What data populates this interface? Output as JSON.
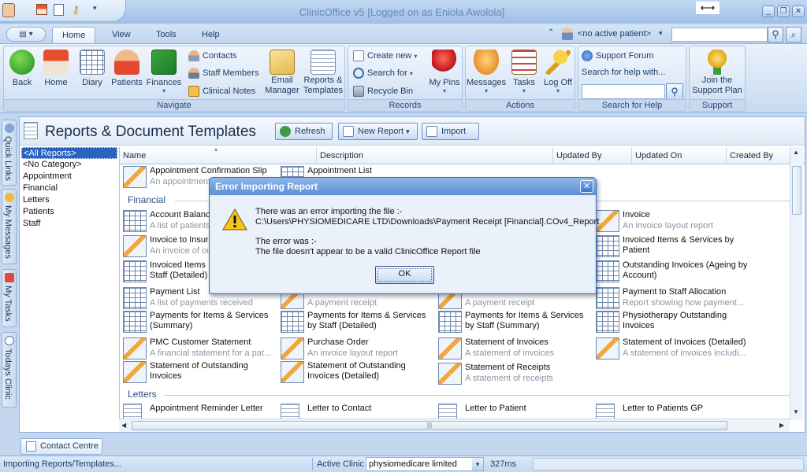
{
  "window": {
    "title": "ClinicOffice v5 [Logged on as Eniola Awolola]"
  },
  "tabs": [
    "Home",
    "View",
    "Tools",
    "Help"
  ],
  "patient_selector": "<no active patient>",
  "ribbon": {
    "navigate": {
      "label": "Navigate",
      "back": "Back",
      "home": "Home",
      "diary": "Diary",
      "patients": "Patients",
      "finances": "Finances",
      "contacts": "Contacts",
      "staff_members": "Staff Members",
      "clinical_notes": "Clinical Notes",
      "email_manager": "Email Manager",
      "reports_templates": "Reports & Templates"
    },
    "records": {
      "label": "Records",
      "create_new": "Create new",
      "search_for": "Search for",
      "recycle_bin": "Recycle Bin",
      "my_pins": "My Pins"
    },
    "actions": {
      "label": "Actions",
      "messages": "Messages",
      "tasks": "Tasks",
      "log_off": "Log Off"
    },
    "search_help": {
      "label": "Search for Help",
      "support_forum": "Support Forum",
      "search_prompt": "Search for help with..."
    },
    "support": {
      "label": "Support",
      "join_plan": "Join the Support Plan"
    }
  },
  "side_tabs": [
    "Quick Links",
    "My Messages",
    "My Tasks",
    "Todays Clinic"
  ],
  "page": {
    "title": "Reports & Document Templates",
    "refresh": "Refresh",
    "new_report": "New Report",
    "import": "Import"
  },
  "categories": [
    "<All Reports>",
    "<No Category>",
    "Appointment",
    "Financial",
    "Letters",
    "Patients",
    "Staff"
  ],
  "columns": [
    "Name",
    "Description",
    "Updated By",
    "Updated On",
    "Created By"
  ],
  "groups": {
    "financial": "Financial",
    "letters": "Letters"
  },
  "appointment_items": [
    {
      "name": "Appointment Confirmation Slip",
      "desc": "An appointment..."
    },
    {
      "name": "Appointment List",
      "desc": ""
    }
  ],
  "financial_items": [
    {
      "name": "Account Balance",
      "desc": "A list of patients"
    },
    {
      "name": "Invoice",
      "desc": "An invoice layout report"
    },
    {
      "name": "Invoice to Insur",
      "desc": "An invoice of ou"
    },
    {
      "name": "Invoiced Items & Services by Patient",
      "desc": ""
    },
    {
      "name": "Invoiced Items Staff (Detailed)",
      "desc": ""
    },
    {
      "name": "Outstanding Invoices (Ageing by Account)",
      "desc": ""
    },
    {
      "name": "Payment List",
      "desc": "A list of payments received"
    },
    {
      "name": "",
      "desc": "A payment receipt"
    },
    {
      "name": "",
      "desc": "A payment receipt"
    },
    {
      "name": "Payment to Staff Allocation",
      "desc": "Report showing how payment..."
    },
    {
      "name": "Payments for Items & Services (Summary)",
      "desc": ""
    },
    {
      "name": "Payments for Items & Services by Staff (Detailed)",
      "desc": ""
    },
    {
      "name": "Payments for Items & Services by Staff (Summary)",
      "desc": ""
    },
    {
      "name": "Physiotherapy Outstanding Invoices",
      "desc": ""
    },
    {
      "name": "PMC Customer Statement",
      "desc": "A financial statement for a pat..."
    },
    {
      "name": "Purchase Order",
      "desc": "An invoice layout report"
    },
    {
      "name": "Statement of Invoices",
      "desc": "A statement of invoices"
    },
    {
      "name": "Statement of Invoices (Detailed)",
      "desc": "A statement of invoices includi..."
    },
    {
      "name": "Statement of Outstanding Invoices",
      "desc": ""
    },
    {
      "name": "Statement of Outstanding Invoices (Detailed)",
      "desc": ""
    },
    {
      "name": "Statement of Receipts",
      "desc": "A statement of receipts"
    }
  ],
  "letter_items": [
    {
      "name": "Appointment Reminder Letter"
    },
    {
      "name": "Letter to Contact"
    },
    {
      "name": "Letter to Patient"
    },
    {
      "name": "Letter to Patients GP"
    }
  ],
  "dialog": {
    "title": "Error Importing Report",
    "line1": "There was an error importing the file :-",
    "line2": "C:\\Users\\PHYSIOMEDICARE LTD\\Downloads\\Payment Receipt [Financial].COv4_Report",
    "line3": "The error was :-",
    "line4": "The file doesn't appear to be a valid ClinicOffice Report file",
    "ok": "OK"
  },
  "contact_centre": "Contact Centre",
  "status": {
    "message": "Importing Reports/Templates...",
    "active_clinic_label": "Active Clinic",
    "active_clinic_value": "physiomedicare limited",
    "timing": "327ms"
  },
  "colors": {
    "accent": "#2b62c0",
    "ribbon": "#d2e2f5",
    "dialog_title": "#5b8fd6"
  }
}
